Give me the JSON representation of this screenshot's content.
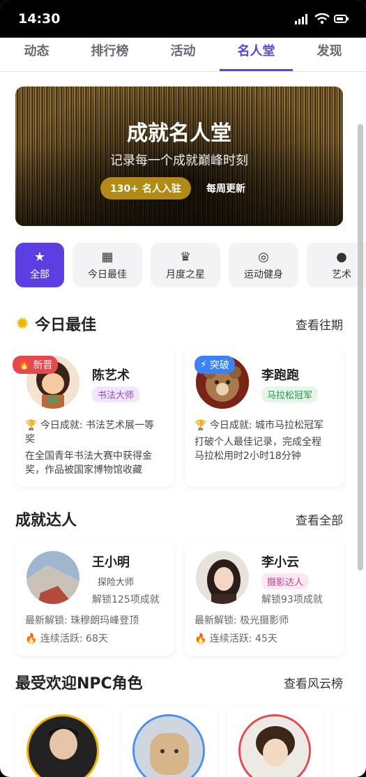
{
  "status": {
    "time": "14:30"
  },
  "tabs": [
    "动态",
    "排行榜",
    "活动",
    "名人堂",
    "发现"
  ],
  "banner": {
    "title": "成就名人堂",
    "subtitle": "记录每一个成就巅峰时刻",
    "pill": "130+ 名人入驻",
    "weekly": "每周更新"
  },
  "categories": [
    "全部",
    "今日最佳",
    "月度之星",
    "运动健身",
    "艺术"
  ],
  "today": {
    "title": "今日最佳",
    "more": "查看往期",
    "cards": [
      {
        "badge": "新晋",
        "name": "陈艺术",
        "tag": "书法大师",
        "achievement": "今日成就: 书法艺术展一等",
        "achievement2": "奖",
        "desc1": "在全国青年书法大赛中获得金",
        "desc2": "奖，作品被国家博物馆收藏"
      },
      {
        "badge": "突破",
        "name": "李跑跑",
        "tag": "马拉松冠军",
        "achievement": "今日成就: 城市马拉松冠军",
        "desc1": "打破个人最佳记录，完成全程",
        "desc2": "马拉松用时2小时18分钟"
      }
    ]
  },
  "experts": {
    "title": "成就达人",
    "more": "查看全部",
    "cards": [
      {
        "name": "王小明",
        "tag": "探险大师",
        "unlocked": "解锁125项成就",
        "latest": "最新解锁: 珠穆朗玛峰登顶",
        "streak": "连续活跃: 68天"
      },
      {
        "name": "李小云",
        "tag": "摄影达人",
        "unlocked": "解锁93项成就",
        "latest": "最新解锁: 极光摄影师",
        "streak": "连续活跃: 45天"
      }
    ]
  },
  "npc": {
    "title": "最受欢迎NPC角色",
    "more": "查看风云榜"
  },
  "colors": {
    "accent": "#5b45d6",
    "gold": "#b28a16",
    "red": "#e5484d",
    "blue": "#3b82f6"
  }
}
